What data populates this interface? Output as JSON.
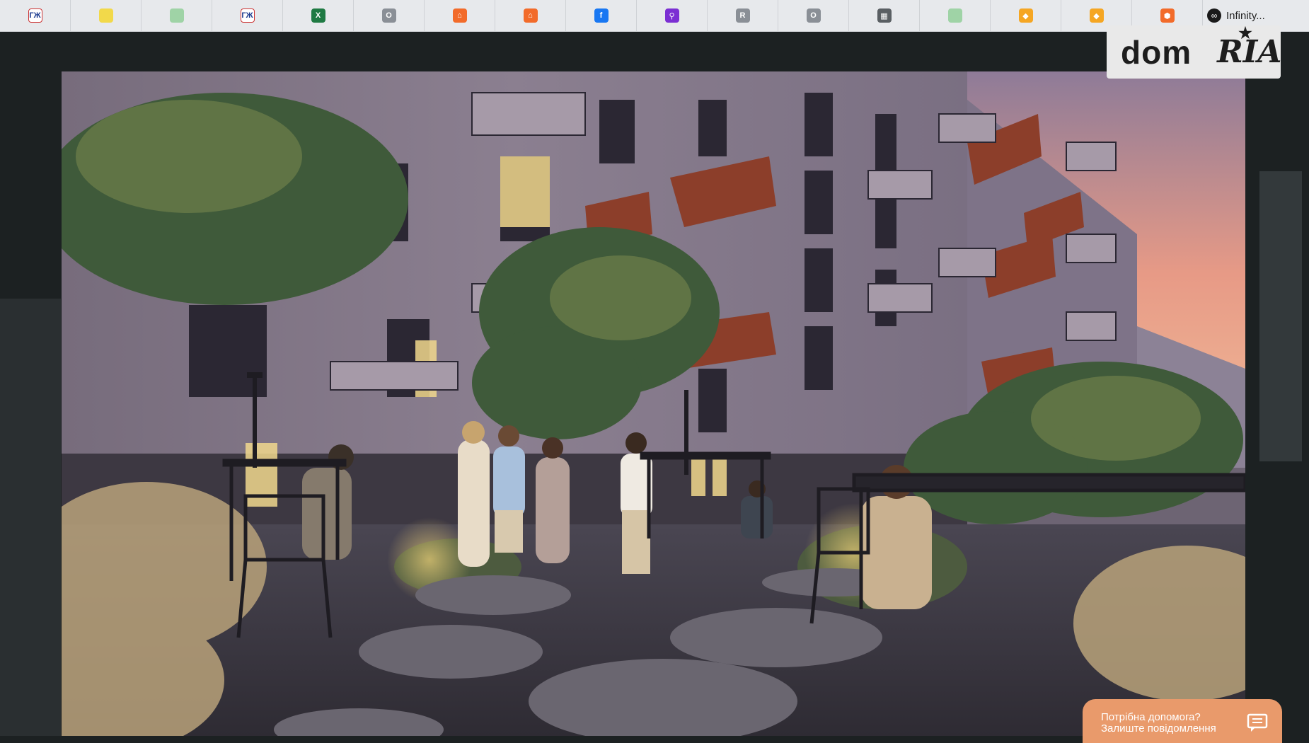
{
  "bookmarks": [
    {
      "icon": "gzh-icon",
      "label": "ГЖ",
      "color": "#ffffff",
      "fg": "#1a3a8f"
    },
    {
      "icon": "lightbulb-icon",
      "label": "",
      "color": "#f2d94a",
      "fg": "#ffffff"
    },
    {
      "icon": "sheet-icon",
      "label": "",
      "color": "#9fd3a6",
      "fg": "#ffffff"
    },
    {
      "icon": "gzh-icon",
      "label": "ГЖ",
      "color": "#ffffff",
      "fg": "#1a3a8f"
    },
    {
      "icon": "excel-icon",
      "label": "X",
      "color": "#1f7a43",
      "fg": "#ffffff"
    },
    {
      "icon": "o-icon",
      "label": "O",
      "color": "#8a8f96",
      "fg": "#ffffff"
    },
    {
      "icon": "home-icon",
      "label": "⌂",
      "color": "#f26b2a",
      "fg": "#ffffff"
    },
    {
      "icon": "home-icon",
      "label": "⌂",
      "color": "#f26b2a",
      "fg": "#ffffff"
    },
    {
      "icon": "facebook-icon",
      "label": "f",
      "color": "#1877f2",
      "fg": "#ffffff"
    },
    {
      "icon": "purple-app-icon",
      "label": "⚲",
      "color": "#7b2fd3",
      "fg": "#ffffff"
    },
    {
      "icon": "r-icon",
      "label": "R",
      "color": "#8a8f96",
      "fg": "#ffffff"
    },
    {
      "icon": "o-icon",
      "label": "O",
      "color": "#8a8f96",
      "fg": "#ffffff"
    },
    {
      "icon": "building-icon",
      "label": "▦",
      "color": "#5a5f63",
      "fg": "#ffffff"
    },
    {
      "icon": "sheet-icon",
      "label": "",
      "color": "#9fd3a6",
      "fg": "#ffffff"
    },
    {
      "icon": "yellow-app-icon",
      "label": "◆",
      "color": "#f5a623",
      "fg": "#ffffff"
    },
    {
      "icon": "yellow-app-icon",
      "label": "◆",
      "color": "#f5a623",
      "fg": "#ffffff"
    },
    {
      "icon": "orange-cube-icon",
      "label": "⬢",
      "color": "#f26b2a",
      "fg": "#ffffff"
    }
  ],
  "infinity": {
    "label": "Infinity..."
  },
  "logo": {
    "dom": "dom",
    "ria": "RIA"
  },
  "help": {
    "line1": "Потрібна допомога?",
    "line2": "Залиште повідомлення"
  },
  "colors": {
    "help_bg": "#e99a6b",
    "page_bg": "#1c2122"
  }
}
